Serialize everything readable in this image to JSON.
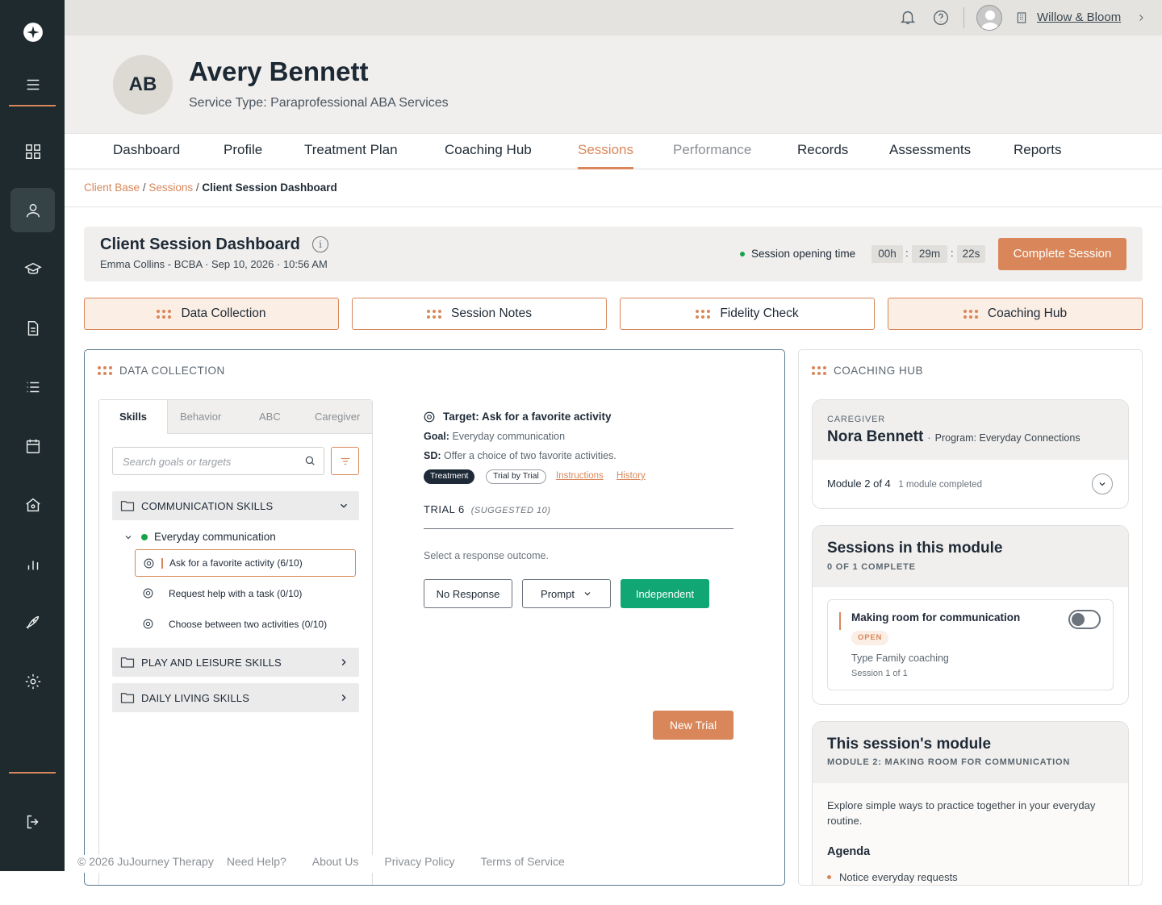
{
  "app": {
    "org_name": "Willow & Bloom",
    "brand_color": "#d9875a",
    "sidebar_color": "#1e2a2e"
  },
  "client": {
    "initials": "AB",
    "name": "Avery Bennett",
    "service_type": "Service Type: Paraprofessional ABA Services"
  },
  "nav_tabs": [
    {
      "label": "Dashboard"
    },
    {
      "label": "Profile"
    },
    {
      "label": "Treatment Plan"
    },
    {
      "label": "Coaching Hub"
    },
    {
      "label": "Sessions",
      "active": true
    },
    {
      "label": "Performance",
      "muted": true
    },
    {
      "label": "Records"
    },
    {
      "label": "Assessments"
    },
    {
      "label": "Reports"
    }
  ],
  "breadcrumb": {
    "items": [
      "Client Base",
      "Sessions"
    ],
    "current": "Client Session Dashboard",
    "sep": "/"
  },
  "dashboard": {
    "title": "Client Session Dashboard",
    "subtitle": "Emma Collins - BCBA · Sep 10, 2026 · 10:56 AM",
    "timer_label": "Session opening time",
    "timer": {
      "h": "00h",
      "m": "29m",
      "s": "22s",
      "sep": ":"
    },
    "complete_button": "Complete Session"
  },
  "panel_tabs": [
    "Data Collection",
    "Session Notes",
    "Fidelity Check",
    "Coaching Hub"
  ],
  "data_collection": {
    "title": "DATA COLLECTION",
    "skill_tabs": [
      "Skills",
      "Behavior",
      "ABC",
      "Caregiver"
    ],
    "search_placeholder": "Search goals or targets",
    "categories": [
      "COMMUNICATION SKILLS",
      "PLAY AND LEISURE SKILLS",
      "DAILY LIVING SKILLS"
    ],
    "goal": "Everyday communication",
    "targets": [
      "Ask for a favorite activity (6/10)",
      "Request help with a task (0/10)",
      "Choose between two activities (0/10)"
    ],
    "detail": {
      "target_title": "Target: Ask for a favorite activity",
      "goal_label": "Goal:",
      "goal_value": "Everyday communication",
      "sd_label": "SD:",
      "sd_value": "Offer a choice of two favorite activities.",
      "tags": [
        "Treatment",
        "Trial by Trial"
      ],
      "links": [
        "Instructions",
        "History"
      ],
      "trial": "TRIAL 6",
      "suggested": "(SUGGESTED 10)",
      "select_prompt": "Select a response outcome.",
      "responses": [
        "No Response",
        "Prompt",
        "Independent"
      ],
      "new_trial": "New Trial"
    }
  },
  "coaching_hub": {
    "title": "COACHING HUB",
    "caregiver_label": "CAREGIVER",
    "caregiver_name": "Nora Bennett",
    "program": "Program: Everyday Connections",
    "module": "Module 2 of 4",
    "module_status": "1 module completed",
    "sessions_title": "Sessions in this module",
    "sessions_sub": "0 OF 1 COMPLETE",
    "session_name": "Making room for communication",
    "session_badge": "OPEN",
    "session_type": "Type Family coaching",
    "session_count": "Session 1 of 1",
    "this_module_title": "This session's module",
    "this_module_sub": "MODULE 2: MAKING ROOM FOR COMMUNICATION",
    "description": "Explore simple ways to practice together in your everyday routine.",
    "agenda_title": "Agenda",
    "agenda": [
      "Notice everyday requests"
    ]
  },
  "footer": {
    "copyright": "© 2026 JuJourney Therapy",
    "links": [
      "Need Help?",
      "About Us",
      "Privacy Policy",
      "Terms of Service"
    ]
  }
}
